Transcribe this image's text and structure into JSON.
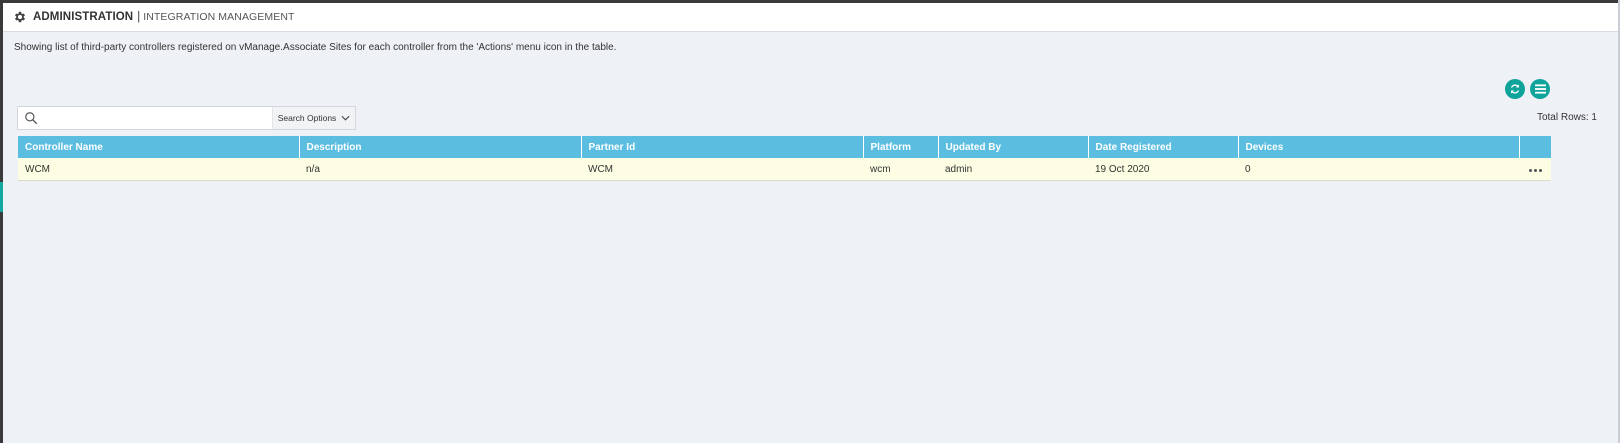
{
  "header": {
    "title": "ADMINISTRATION",
    "separator": "|",
    "subtitle": "INTEGRATION MANAGEMENT",
    "icon": "gear-icon"
  },
  "description": "Showing list of third-party controllers registered on vManage.Associate Sites for each controller from the 'Actions' menu icon in the table.",
  "toolbar": {
    "refresh_icon": "refresh-icon",
    "menu_icon": "table-menu-icon",
    "accent_color": "#0ea39b"
  },
  "search": {
    "value": "",
    "placeholder": "",
    "options_label": "Search Options"
  },
  "total_rows": "Total Rows: 1",
  "table": {
    "header_color": "#5bbde0",
    "columns": [
      "Controller Name",
      "Description",
      "Partner Id",
      "Platform",
      "Updated By",
      "Date Registered",
      "Devices",
      ""
    ],
    "rows": [
      {
        "controller_name": "WCM",
        "description": "n/a",
        "partner_id": "WCM",
        "platform": "wcm",
        "updated_by": "admin",
        "date_registered": "19 Oct 2020",
        "devices": "0"
      }
    ]
  }
}
